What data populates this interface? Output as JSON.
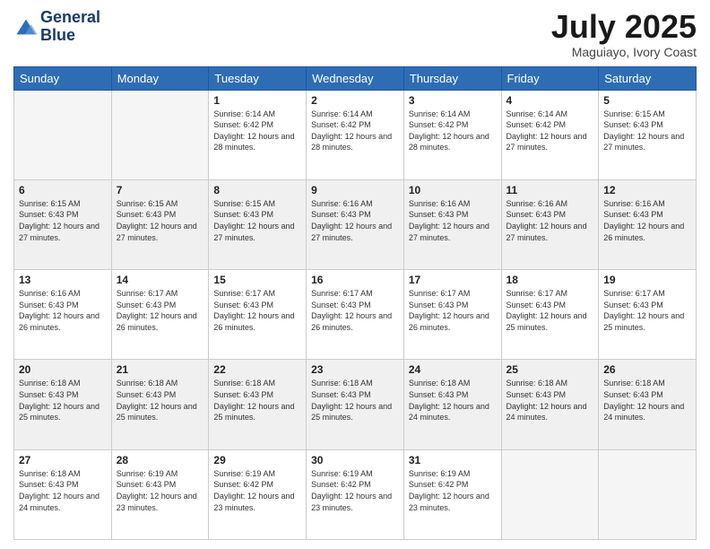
{
  "header": {
    "logo_line1": "General",
    "logo_line2": "Blue",
    "month": "July 2025",
    "location": "Maguiayo, Ivory Coast"
  },
  "weekdays": [
    "Sunday",
    "Monday",
    "Tuesday",
    "Wednesday",
    "Thursday",
    "Friday",
    "Saturday"
  ],
  "weeks": [
    [
      {
        "day": "",
        "info": ""
      },
      {
        "day": "",
        "info": ""
      },
      {
        "day": "1",
        "info": "Sunrise: 6:14 AM\nSunset: 6:42 PM\nDaylight: 12 hours and 28 minutes."
      },
      {
        "day": "2",
        "info": "Sunrise: 6:14 AM\nSunset: 6:42 PM\nDaylight: 12 hours and 28 minutes."
      },
      {
        "day": "3",
        "info": "Sunrise: 6:14 AM\nSunset: 6:42 PM\nDaylight: 12 hours and 28 minutes."
      },
      {
        "day": "4",
        "info": "Sunrise: 6:14 AM\nSunset: 6:42 PM\nDaylight: 12 hours and 27 minutes."
      },
      {
        "day": "5",
        "info": "Sunrise: 6:15 AM\nSunset: 6:43 PM\nDaylight: 12 hours and 27 minutes."
      }
    ],
    [
      {
        "day": "6",
        "info": "Sunrise: 6:15 AM\nSunset: 6:43 PM\nDaylight: 12 hours and 27 minutes."
      },
      {
        "day": "7",
        "info": "Sunrise: 6:15 AM\nSunset: 6:43 PM\nDaylight: 12 hours and 27 minutes."
      },
      {
        "day": "8",
        "info": "Sunrise: 6:15 AM\nSunset: 6:43 PM\nDaylight: 12 hours and 27 minutes."
      },
      {
        "day": "9",
        "info": "Sunrise: 6:16 AM\nSunset: 6:43 PM\nDaylight: 12 hours and 27 minutes."
      },
      {
        "day": "10",
        "info": "Sunrise: 6:16 AM\nSunset: 6:43 PM\nDaylight: 12 hours and 27 minutes."
      },
      {
        "day": "11",
        "info": "Sunrise: 6:16 AM\nSunset: 6:43 PM\nDaylight: 12 hours and 27 minutes."
      },
      {
        "day": "12",
        "info": "Sunrise: 6:16 AM\nSunset: 6:43 PM\nDaylight: 12 hours and 26 minutes."
      }
    ],
    [
      {
        "day": "13",
        "info": "Sunrise: 6:16 AM\nSunset: 6:43 PM\nDaylight: 12 hours and 26 minutes."
      },
      {
        "day": "14",
        "info": "Sunrise: 6:17 AM\nSunset: 6:43 PM\nDaylight: 12 hours and 26 minutes."
      },
      {
        "day": "15",
        "info": "Sunrise: 6:17 AM\nSunset: 6:43 PM\nDaylight: 12 hours and 26 minutes."
      },
      {
        "day": "16",
        "info": "Sunrise: 6:17 AM\nSunset: 6:43 PM\nDaylight: 12 hours and 26 minutes."
      },
      {
        "day": "17",
        "info": "Sunrise: 6:17 AM\nSunset: 6:43 PM\nDaylight: 12 hours and 26 minutes."
      },
      {
        "day": "18",
        "info": "Sunrise: 6:17 AM\nSunset: 6:43 PM\nDaylight: 12 hours and 25 minutes."
      },
      {
        "day": "19",
        "info": "Sunrise: 6:17 AM\nSunset: 6:43 PM\nDaylight: 12 hours and 25 minutes."
      }
    ],
    [
      {
        "day": "20",
        "info": "Sunrise: 6:18 AM\nSunset: 6:43 PM\nDaylight: 12 hours and 25 minutes."
      },
      {
        "day": "21",
        "info": "Sunrise: 6:18 AM\nSunset: 6:43 PM\nDaylight: 12 hours and 25 minutes."
      },
      {
        "day": "22",
        "info": "Sunrise: 6:18 AM\nSunset: 6:43 PM\nDaylight: 12 hours and 25 minutes."
      },
      {
        "day": "23",
        "info": "Sunrise: 6:18 AM\nSunset: 6:43 PM\nDaylight: 12 hours and 25 minutes."
      },
      {
        "day": "24",
        "info": "Sunrise: 6:18 AM\nSunset: 6:43 PM\nDaylight: 12 hours and 24 minutes."
      },
      {
        "day": "25",
        "info": "Sunrise: 6:18 AM\nSunset: 6:43 PM\nDaylight: 12 hours and 24 minutes."
      },
      {
        "day": "26",
        "info": "Sunrise: 6:18 AM\nSunset: 6:43 PM\nDaylight: 12 hours and 24 minutes."
      }
    ],
    [
      {
        "day": "27",
        "info": "Sunrise: 6:18 AM\nSunset: 6:43 PM\nDaylight: 12 hours and 24 minutes."
      },
      {
        "day": "28",
        "info": "Sunrise: 6:19 AM\nSunset: 6:43 PM\nDaylight: 12 hours and 23 minutes."
      },
      {
        "day": "29",
        "info": "Sunrise: 6:19 AM\nSunset: 6:42 PM\nDaylight: 12 hours and 23 minutes."
      },
      {
        "day": "30",
        "info": "Sunrise: 6:19 AM\nSunset: 6:42 PM\nDaylight: 12 hours and 23 minutes."
      },
      {
        "day": "31",
        "info": "Sunrise: 6:19 AM\nSunset: 6:42 PM\nDaylight: 12 hours and 23 minutes."
      },
      {
        "day": "",
        "info": ""
      },
      {
        "day": "",
        "info": ""
      }
    ]
  ]
}
